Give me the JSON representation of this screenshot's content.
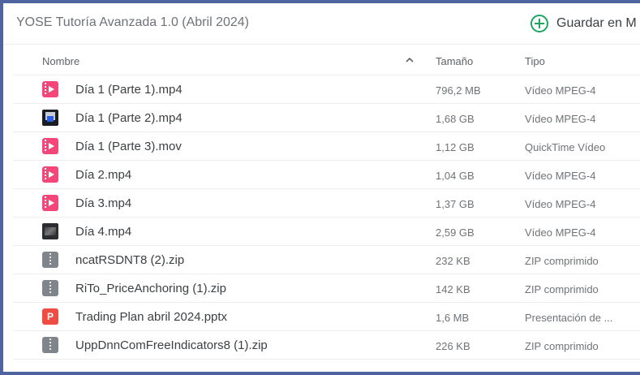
{
  "header": {
    "folder_title": "YOSE Tutoría Avanzada 1.0 (Abril 2024)",
    "save_label": "Guardar en M",
    "accent_color": "#1fa463"
  },
  "columns": {
    "name": "Nombre",
    "sort_indicator": "^",
    "size": "Tamaño",
    "type": "Tipo"
  },
  "files": [
    {
      "name": "Día 1 (Parte 1).mp4",
      "size": "796,2 MB",
      "type": "Vídeo MPEG-4",
      "icon": "video-file-icon"
    },
    {
      "name": "Día 1 (Parte 2).mp4",
      "size": "1,68 GB",
      "type": "Vídeo MPEG-4",
      "icon": "video-thumbnail-icon"
    },
    {
      "name": "Día 1 (Parte 3).mov",
      "size": "1,12 GB",
      "type": "QuickTime Vídeo",
      "icon": "video-file-icon"
    },
    {
      "name": "Día 2.mp4",
      "size": "1,04 GB",
      "type": "Vídeo MPEG-4",
      "icon": "video-file-icon"
    },
    {
      "name": "Día 3.mp4",
      "size": "1,37 GB",
      "type": "Vídeo MPEG-4",
      "icon": "video-file-icon"
    },
    {
      "name": "Día 4.mp4",
      "size": "2,59 GB",
      "type": "Vídeo MPEG-4",
      "icon": "video-thumbnail-icon"
    },
    {
      "name": "ncatRSDNT8 (2).zip",
      "size": "232 KB",
      "type": "ZIP comprimido",
      "icon": "zip-file-icon"
    },
    {
      "name": "RiTo_PriceAnchoring (1).zip",
      "size": "142 KB",
      "type": "ZIP comprimido",
      "icon": "zip-file-icon"
    },
    {
      "name": "Trading Plan abril 2024.pptx",
      "size": "1,6 MB",
      "type": "Presentación de ...",
      "icon": "pptx-file-icon",
      "icon_letter": "P"
    },
    {
      "name": "UppDnnComFreeIndicators8 (1).zip",
      "size": "226 KB",
      "type": "ZIP comprimido",
      "icon": "zip-file-icon"
    }
  ]
}
